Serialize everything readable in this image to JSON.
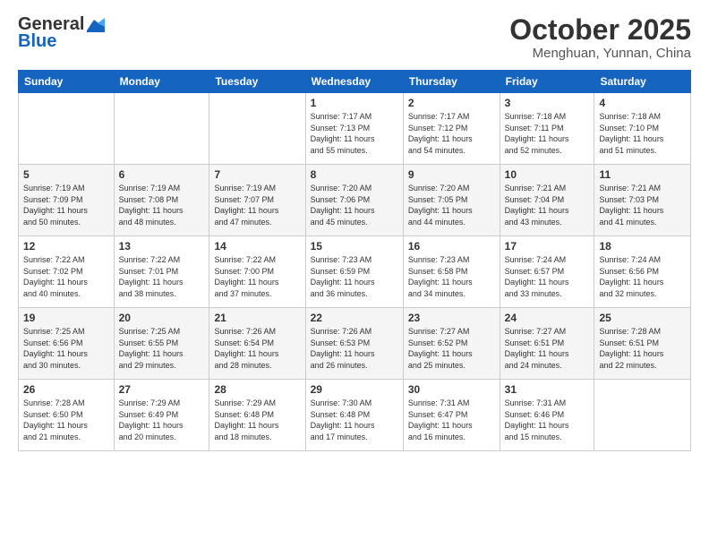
{
  "header": {
    "logo_general": "General",
    "logo_blue": "Blue",
    "month_title": "October 2025",
    "location": "Menghuan, Yunnan, China"
  },
  "days_of_week": [
    "Sunday",
    "Monday",
    "Tuesday",
    "Wednesday",
    "Thursday",
    "Friday",
    "Saturday"
  ],
  "weeks": [
    [
      {
        "day": "",
        "info": ""
      },
      {
        "day": "",
        "info": ""
      },
      {
        "day": "",
        "info": ""
      },
      {
        "day": "1",
        "info": "Sunrise: 7:17 AM\nSunset: 7:13 PM\nDaylight: 11 hours\nand 55 minutes."
      },
      {
        "day": "2",
        "info": "Sunrise: 7:17 AM\nSunset: 7:12 PM\nDaylight: 11 hours\nand 54 minutes."
      },
      {
        "day": "3",
        "info": "Sunrise: 7:18 AM\nSunset: 7:11 PM\nDaylight: 11 hours\nand 52 minutes."
      },
      {
        "day": "4",
        "info": "Sunrise: 7:18 AM\nSunset: 7:10 PM\nDaylight: 11 hours\nand 51 minutes."
      }
    ],
    [
      {
        "day": "5",
        "info": "Sunrise: 7:19 AM\nSunset: 7:09 PM\nDaylight: 11 hours\nand 50 minutes."
      },
      {
        "day": "6",
        "info": "Sunrise: 7:19 AM\nSunset: 7:08 PM\nDaylight: 11 hours\nand 48 minutes."
      },
      {
        "day": "7",
        "info": "Sunrise: 7:19 AM\nSunset: 7:07 PM\nDaylight: 11 hours\nand 47 minutes."
      },
      {
        "day": "8",
        "info": "Sunrise: 7:20 AM\nSunset: 7:06 PM\nDaylight: 11 hours\nand 45 minutes."
      },
      {
        "day": "9",
        "info": "Sunrise: 7:20 AM\nSunset: 7:05 PM\nDaylight: 11 hours\nand 44 minutes."
      },
      {
        "day": "10",
        "info": "Sunrise: 7:21 AM\nSunset: 7:04 PM\nDaylight: 11 hours\nand 43 minutes."
      },
      {
        "day": "11",
        "info": "Sunrise: 7:21 AM\nSunset: 7:03 PM\nDaylight: 11 hours\nand 41 minutes."
      }
    ],
    [
      {
        "day": "12",
        "info": "Sunrise: 7:22 AM\nSunset: 7:02 PM\nDaylight: 11 hours\nand 40 minutes."
      },
      {
        "day": "13",
        "info": "Sunrise: 7:22 AM\nSunset: 7:01 PM\nDaylight: 11 hours\nand 38 minutes."
      },
      {
        "day": "14",
        "info": "Sunrise: 7:22 AM\nSunset: 7:00 PM\nDaylight: 11 hours\nand 37 minutes."
      },
      {
        "day": "15",
        "info": "Sunrise: 7:23 AM\nSunset: 6:59 PM\nDaylight: 11 hours\nand 36 minutes."
      },
      {
        "day": "16",
        "info": "Sunrise: 7:23 AM\nSunset: 6:58 PM\nDaylight: 11 hours\nand 34 minutes."
      },
      {
        "day": "17",
        "info": "Sunrise: 7:24 AM\nSunset: 6:57 PM\nDaylight: 11 hours\nand 33 minutes."
      },
      {
        "day": "18",
        "info": "Sunrise: 7:24 AM\nSunset: 6:56 PM\nDaylight: 11 hours\nand 32 minutes."
      }
    ],
    [
      {
        "day": "19",
        "info": "Sunrise: 7:25 AM\nSunset: 6:56 PM\nDaylight: 11 hours\nand 30 minutes."
      },
      {
        "day": "20",
        "info": "Sunrise: 7:25 AM\nSunset: 6:55 PM\nDaylight: 11 hours\nand 29 minutes."
      },
      {
        "day": "21",
        "info": "Sunrise: 7:26 AM\nSunset: 6:54 PM\nDaylight: 11 hours\nand 28 minutes."
      },
      {
        "day": "22",
        "info": "Sunrise: 7:26 AM\nSunset: 6:53 PM\nDaylight: 11 hours\nand 26 minutes."
      },
      {
        "day": "23",
        "info": "Sunrise: 7:27 AM\nSunset: 6:52 PM\nDaylight: 11 hours\nand 25 minutes."
      },
      {
        "day": "24",
        "info": "Sunrise: 7:27 AM\nSunset: 6:51 PM\nDaylight: 11 hours\nand 24 minutes."
      },
      {
        "day": "25",
        "info": "Sunrise: 7:28 AM\nSunset: 6:51 PM\nDaylight: 11 hours\nand 22 minutes."
      }
    ],
    [
      {
        "day": "26",
        "info": "Sunrise: 7:28 AM\nSunset: 6:50 PM\nDaylight: 11 hours\nand 21 minutes."
      },
      {
        "day": "27",
        "info": "Sunrise: 7:29 AM\nSunset: 6:49 PM\nDaylight: 11 hours\nand 20 minutes."
      },
      {
        "day": "28",
        "info": "Sunrise: 7:29 AM\nSunset: 6:48 PM\nDaylight: 11 hours\nand 18 minutes."
      },
      {
        "day": "29",
        "info": "Sunrise: 7:30 AM\nSunset: 6:48 PM\nDaylight: 11 hours\nand 17 minutes."
      },
      {
        "day": "30",
        "info": "Sunrise: 7:31 AM\nSunset: 6:47 PM\nDaylight: 11 hours\nand 16 minutes."
      },
      {
        "day": "31",
        "info": "Sunrise: 7:31 AM\nSunset: 6:46 PM\nDaylight: 11 hours\nand 15 minutes."
      },
      {
        "day": "",
        "info": ""
      }
    ]
  ]
}
